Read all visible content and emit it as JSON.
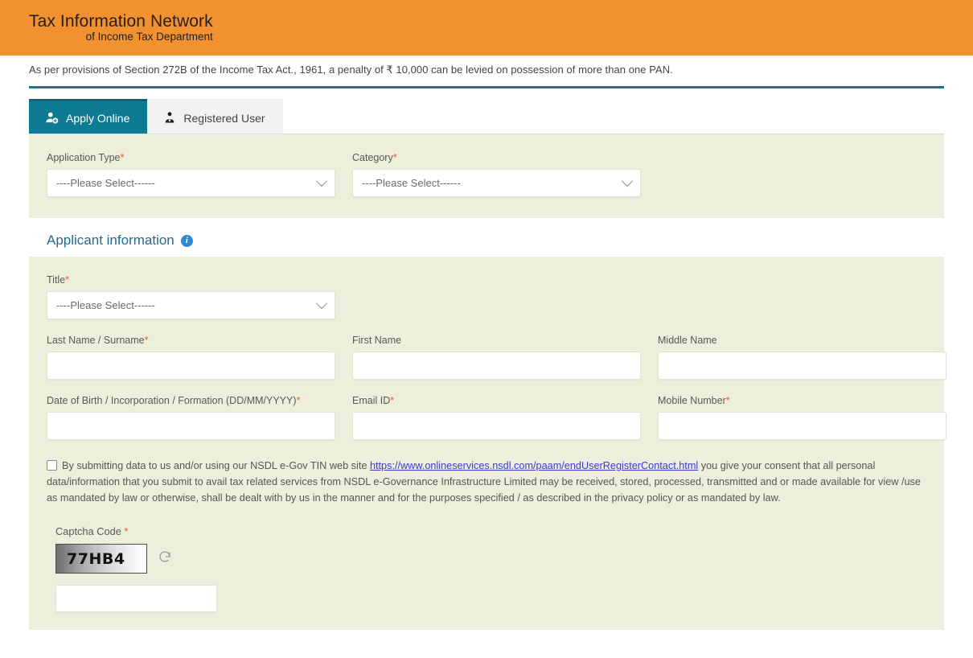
{
  "header": {
    "logo_line1": "Tax Information Network",
    "logo_line2": "of Income Tax Department",
    "brand_color": "#f2912f"
  },
  "notice": {
    "text": "As per provisions of Section 272B of the Income Tax Act., 1961, a penalty of ₹ 10,000 can be levied on possession of more than one PAN.",
    "divider_color": "#17788b"
  },
  "tabs": [
    {
      "label": "Apply Online",
      "icon": "user-plus-icon",
      "active": true,
      "active_color": "#0d7b93"
    },
    {
      "label": "Registered User",
      "icon": "registered-user-icon",
      "active": false
    }
  ],
  "application_panel": {
    "application_type": {
      "label": "Application Type",
      "required": "*",
      "value": "----Please Select------"
    },
    "category": {
      "label": "Category",
      "required": "*",
      "value": "----Please Select------"
    }
  },
  "applicant_section": {
    "heading": "Applicant information",
    "info_icon": "info-icon",
    "title_field": {
      "label": "Title",
      "required": "*",
      "value": "----Please Select------"
    },
    "last_name": {
      "label": "Last Name / Surname",
      "required": "*",
      "value": ""
    },
    "first_name": {
      "label": "First Name",
      "required": "",
      "value": ""
    },
    "middle_name": {
      "label": "Middle Name",
      "required": "",
      "value": ""
    },
    "dob": {
      "label": "Date of Birth / Incorporation / Formation (DD/MM/YYYY)",
      "required": "*",
      "value": ""
    },
    "email": {
      "label": "Email ID",
      "required": "*",
      "value": ""
    },
    "mobile": {
      "label": "Mobile Number",
      "required": "*",
      "value": ""
    }
  },
  "consent": {
    "checked": false,
    "part1": "By submitting data to us and/or using our NSDL e-Gov TIN web site ",
    "link_text": "https://www.onlineservices.nsdl.com/paam/endUserRegisterContact.html",
    "part2": " you give your consent that all personal data/information that you submit to avail tax related services from NSDL e-Governance Infrastructure Limited may be received, stored, processed, transmitted and or made available for view /use as mandated by law or otherwise, shall be dealt with by us in the manner and for the purposes specified / as described in the privacy policy or as mandated by law.",
    "link_color": "#3a3ad0"
  },
  "captcha": {
    "label": "Captcha Code",
    "required": "*",
    "code": "77HB4",
    "refresh_icon": "refresh-icon",
    "input_value": ""
  }
}
